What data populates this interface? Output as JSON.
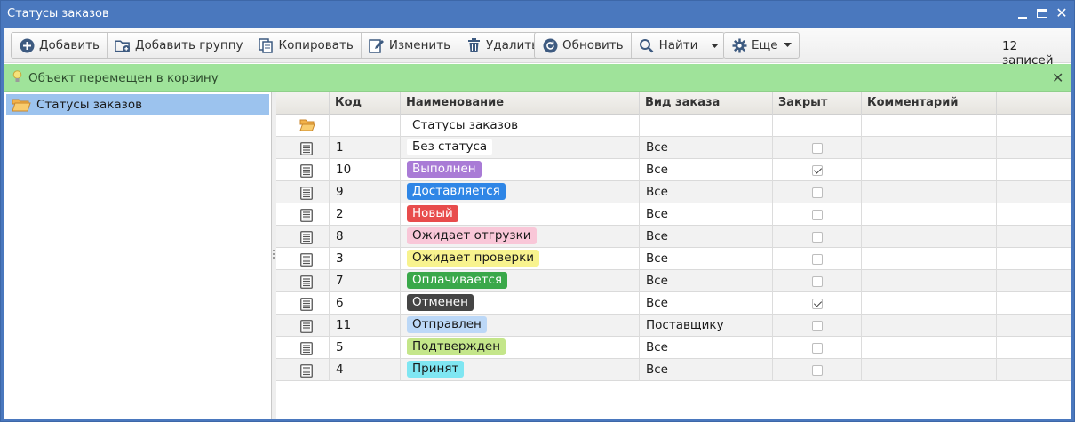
{
  "window": {
    "title": "Статусы заказов"
  },
  "toolbar": {
    "add": "Добавить",
    "add_group": "Добавить группу",
    "copy": "Копировать",
    "edit": "Изменить",
    "delete": "Удалить",
    "refresh": "Обновить",
    "find": "Найти",
    "more": "Еще",
    "records": "12 записей"
  },
  "notice": {
    "message": "Объект перемещен в корзину"
  },
  "tree": {
    "root": "Статусы заказов"
  },
  "grid": {
    "columns": [
      "Код",
      "Наименование",
      "Вид заказа",
      "Закрыт",
      "Комментарий"
    ],
    "folder_row": {
      "name": "Статусы заказов"
    },
    "rows": [
      {
        "code": "1",
        "name": "Без статуса",
        "type": "Все",
        "closed": false,
        "comment": "",
        "tag_bg": "#ffffff",
        "tag_fg": "#1a1a1a"
      },
      {
        "code": "10",
        "name": "Выполнен",
        "type": "Все",
        "closed": true,
        "comment": "",
        "tag_bg": "#a97bd6",
        "tag_fg": "#ffffff"
      },
      {
        "code": "9",
        "name": "Доставляется",
        "type": "Все",
        "closed": false,
        "comment": "",
        "tag_bg": "#2f86e6",
        "tag_fg": "#ffffff"
      },
      {
        "code": "2",
        "name": "Новый",
        "type": "Все",
        "closed": false,
        "comment": "",
        "tag_bg": "#e84c4c",
        "tag_fg": "#ffffff"
      },
      {
        "code": "8",
        "name": "Ожидает отгрузки",
        "type": "Все",
        "closed": false,
        "comment": "",
        "tag_bg": "#f9c7d8",
        "tag_fg": "#1a1a1a"
      },
      {
        "code": "3",
        "name": "Ожидает проверки",
        "type": "Все",
        "closed": false,
        "comment": "",
        "tag_bg": "#f8f38e",
        "tag_fg": "#1a1a1a"
      },
      {
        "code": "7",
        "name": "Оплачивается",
        "type": "Все",
        "closed": false,
        "comment": "",
        "tag_bg": "#3aa84a",
        "tag_fg": "#ffffff"
      },
      {
        "code": "6",
        "name": "Отменен",
        "type": "Все",
        "closed": true,
        "comment": "",
        "tag_bg": "#454545",
        "tag_fg": "#ffffff"
      },
      {
        "code": "11",
        "name": "Отправлен",
        "type": "Поставщику",
        "closed": false,
        "comment": "",
        "tag_bg": "#bcd8f7",
        "tag_fg": "#1a1a1a"
      },
      {
        "code": "5",
        "name": "Подтвержден",
        "type": "Все",
        "closed": false,
        "comment": "",
        "tag_bg": "#c4e68a",
        "tag_fg": "#1a1a1a"
      },
      {
        "code": "4",
        "name": "Принят",
        "type": "Все",
        "closed": false,
        "comment": "",
        "tag_bg": "#7fe6f2",
        "tag_fg": "#1a1a1a"
      }
    ]
  },
  "colors": {
    "titlebar": "#4a78be",
    "notice": "#9fe39a",
    "tree_selected": "#9cc3ee"
  }
}
